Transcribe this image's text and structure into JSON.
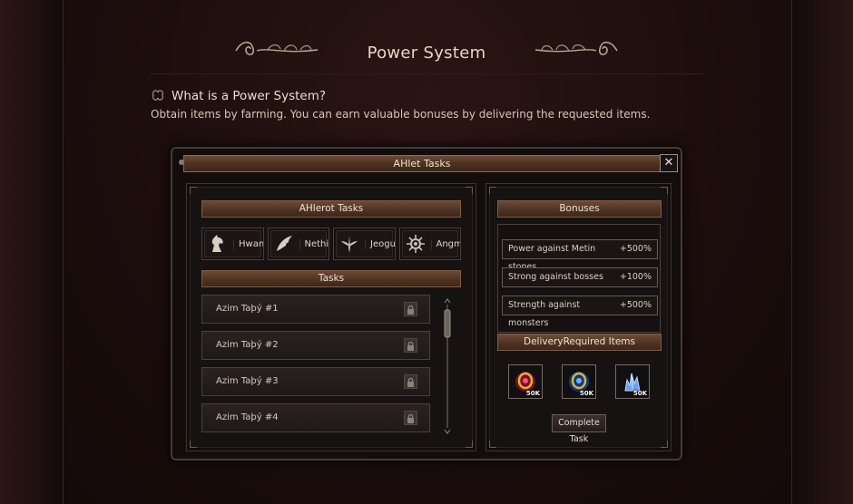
{
  "page": {
    "title": "Power System"
  },
  "info": {
    "heading": "What is a Power System?",
    "description": "Obtain items by farming. You can earn valuable bonuses by delivering the requested items."
  },
  "window": {
    "title": "AHlet Tasks",
    "close_label": "✕"
  },
  "left_panel": {
    "characters_header": "AHlerot Tasks",
    "characters": [
      {
        "label": "Hwan",
        "icon": "horse-icon"
      },
      {
        "label": "Nethis",
        "icon": "wing-icon"
      },
      {
        "label": "Jeogun",
        "icon": "winged-sword-icon"
      },
      {
        "label": "Angmur",
        "icon": "sun-emblem-icon"
      }
    ],
    "tasks_header": "Tasks",
    "tasks": [
      {
        "label": "Azim Taþý #1"
      },
      {
        "label": "Azim Taþý #2"
      },
      {
        "label": "Azim Taþý #3"
      },
      {
        "label": "Azim Taþý #4"
      }
    ]
  },
  "right_panel": {
    "bonuses_header": "Bonuses",
    "bonuses": [
      {
        "label": "Power against Metin stones",
        "value": "+500%"
      },
      {
        "label": "Strong against bosses",
        "value": "+100%"
      },
      {
        "label": "Strength against monsters",
        "value": "+500%"
      }
    ],
    "items_header": "DeliveryRequired Items",
    "items": [
      {
        "badge": "50K",
        "icon": "red-ring-item-icon",
        "color": "#c0304a"
      },
      {
        "badge": "50K",
        "icon": "blue-ring-item-icon",
        "color": "#2a5aa8"
      },
      {
        "badge": "50K",
        "icon": "blue-crystal-item-icon",
        "color": "#5a8ae0"
      }
    ],
    "complete_label": "Complete Task"
  }
}
